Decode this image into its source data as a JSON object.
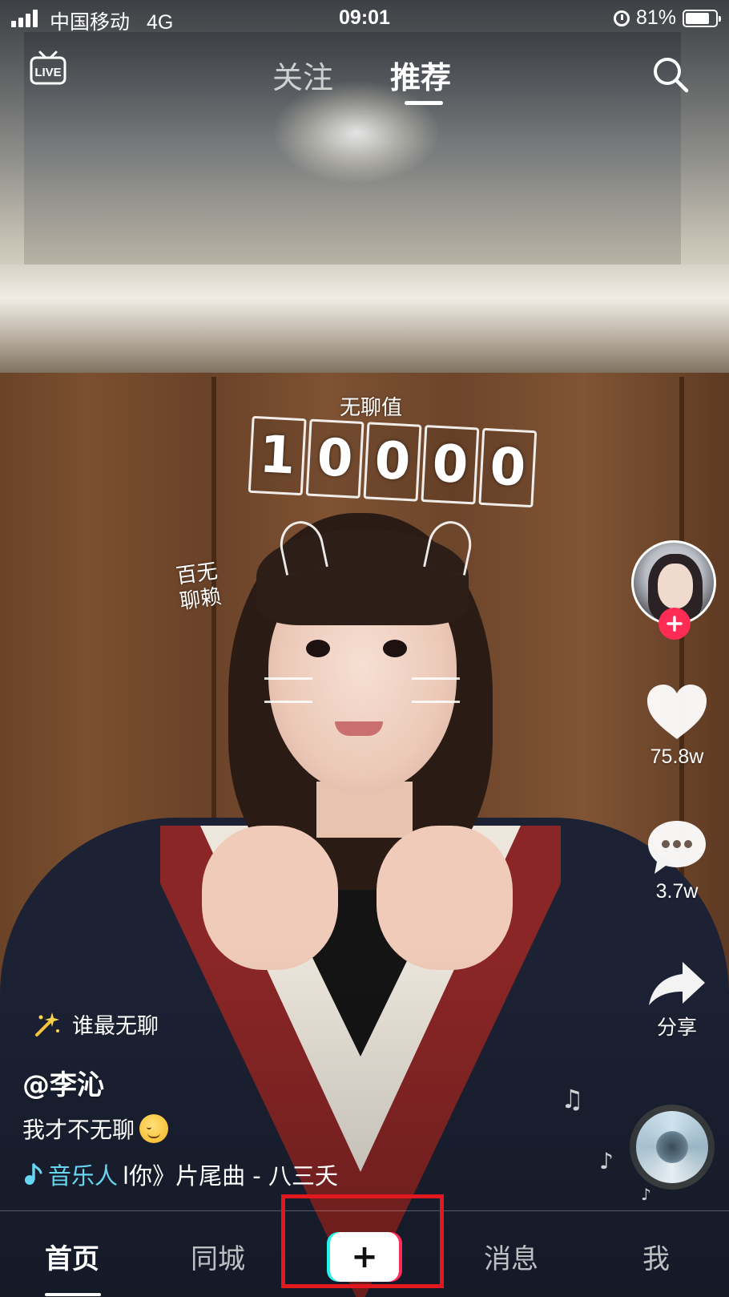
{
  "status_bar": {
    "carrier": "中国移动",
    "network": "4G",
    "time": "09:01",
    "battery": "81%",
    "battery_level": 0.81
  },
  "top_nav": {
    "live_icon": "live-icon",
    "tabs": [
      {
        "label": "关注",
        "active": false
      },
      {
        "label": "推荐",
        "active": true
      }
    ],
    "search_icon": "search-icon"
  },
  "video_overlay": {
    "sticker_caption": "无聊值",
    "counter_digits": [
      "1",
      "0",
      "0",
      "0",
      "0"
    ],
    "side_doodle_line1": "百无",
    "side_doodle_line2": "聊赖"
  },
  "right_rail": {
    "avatar": "creator-avatar",
    "follow_icon": "plus-icon",
    "likes": "75.8w",
    "comments": "3.7w",
    "share_label": "分享",
    "music_disc": "music-disc"
  },
  "video_info": {
    "challenge": "谁最无聊",
    "username": "@李沁",
    "caption": "我才不无聊",
    "caption_emoji": "smirk-emoji",
    "music_artist": "音乐人",
    "music_title": "l你》片尾曲 - 八三夭"
  },
  "bottom_tabs": {
    "home": "首页",
    "city": "同城",
    "create": "+",
    "messages": "消息",
    "me": "我"
  },
  "colors": {
    "accent_red": "#fe2c55",
    "accent_cyan": "#25f4ee",
    "music_artist": "#67d6f2",
    "highlight": "#e1191f"
  }
}
